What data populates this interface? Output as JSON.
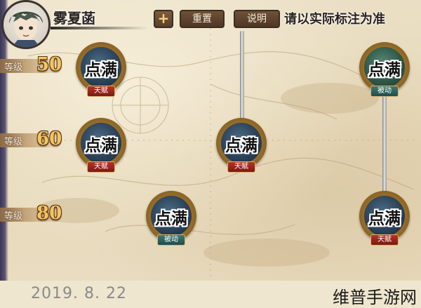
{
  "header": {
    "player_name": "雾夏菡",
    "plus_label": "+",
    "reset_label": "重置",
    "help_label": "说明",
    "note": "请以实际标注为准"
  },
  "levels": [
    {
      "label": "等级",
      "value": "50"
    },
    {
      "label": "等级",
      "value": "60"
    },
    {
      "label": "等级",
      "value": "80"
    }
  ],
  "skills": [
    {
      "label": "点满",
      "type": "天赋",
      "type_color": "#9c2a1d"
    },
    {
      "label": "点满",
      "type": "被动",
      "type_color": "#2f6662"
    },
    {
      "label": "点满",
      "type": "天赋",
      "type_color": "#9c2a1d"
    },
    {
      "label": "点满",
      "type": "天赋",
      "type_color": "#9c2a1d"
    },
    {
      "label": "点满",
      "type": "被动",
      "type_color": "#2f6662"
    },
    {
      "label": "点满",
      "type": "天赋",
      "type_color": "#9c2a1d"
    }
  ],
  "footer": {
    "date": "2019. 8. 22",
    "watermark": "维普手游网"
  }
}
